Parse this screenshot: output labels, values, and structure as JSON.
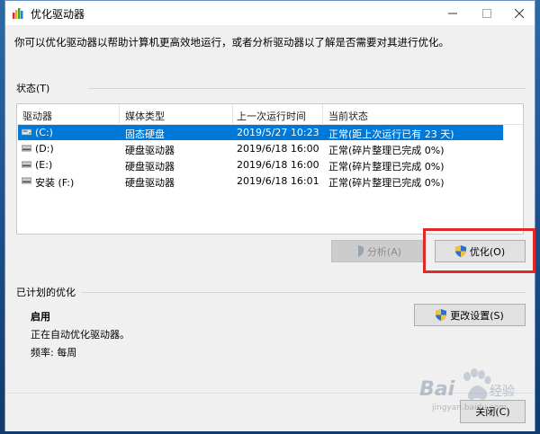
{
  "window": {
    "title": "优化驱动器",
    "intro": "你可以优化驱动器以帮助计算机更高效地运行，或者分析驱动器以了解是否需要对其进行优化。"
  },
  "status_section": {
    "label": "状态(T)",
    "columns": [
      "驱动器",
      "媒体类型",
      "上一次运行时间",
      "当前状态"
    ],
    "rows": [
      {
        "drive": "(C:)",
        "media": "固态硬盘",
        "last_run": "2019/5/27 10:23",
        "status": "正常(距上次运行已有 23 天)",
        "selected": true
      },
      {
        "drive": "(D:)",
        "media": "硬盘驱动器",
        "last_run": "2019/6/18 16:00",
        "status": "正常(碎片整理已完成 0%)",
        "selected": false
      },
      {
        "drive": "(E:)",
        "media": "硬盘驱动器",
        "last_run": "2019/6/18 16:00",
        "status": "正常(碎片整理已完成 0%)",
        "selected": false
      },
      {
        "drive": "安装 (F:)",
        "media": "硬盘驱动器",
        "last_run": "2019/6/18 16:01",
        "status": "正常(碎片整理已完成 0%)",
        "selected": false
      }
    ],
    "analyze_label": "分析(A)",
    "optimize_label": "优化(O)"
  },
  "scheduled_section": {
    "label": "已计划的优化",
    "state": "启用",
    "detail": "正在自动优化驱动器。",
    "frequency": "频率: 每周",
    "change_settings_label": "更改设置(S)"
  },
  "footer": {
    "close_label": "关闭(C)"
  },
  "watermark": {
    "brand": "Bai",
    "suffix": "经验",
    "url": "jingyan.baidu.com"
  },
  "colors": {
    "selection": "#0078d7",
    "highlight_box": "#e02a2a",
    "window_bg": "#f0f0f0"
  }
}
